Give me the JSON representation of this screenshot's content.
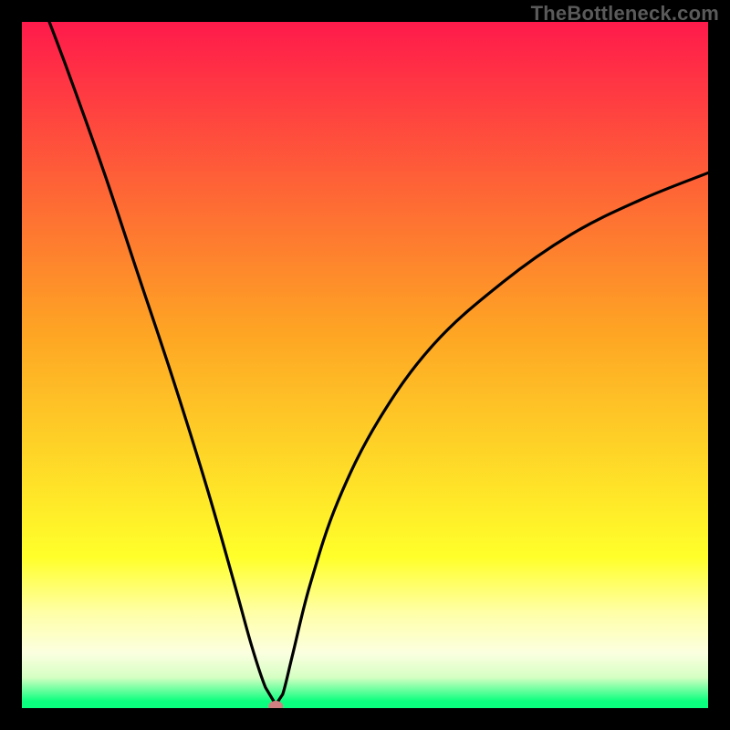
{
  "watermark": "TheBottleneck.com",
  "chart_data": {
    "type": "line",
    "title": "",
    "xlabel": "",
    "ylabel": "",
    "xlim": [
      0,
      100
    ],
    "ylim": [
      0,
      100
    ],
    "minimum_x": 37,
    "gradient_stops": [
      {
        "offset": 0.0,
        "color": "#ff1a4b"
      },
      {
        "offset": 0.45,
        "color": "#fea424"
      },
      {
        "offset": 0.78,
        "color": "#ffff2a"
      },
      {
        "offset": 0.86,
        "color": "#ffffa6"
      },
      {
        "offset": 0.92,
        "color": "#fbffe0"
      },
      {
        "offset": 0.955,
        "color": "#d6ffc3"
      },
      {
        "offset": 0.99,
        "color": "#0bff7e"
      }
    ],
    "marker": {
      "x": 37,
      "y": 0,
      "color": "#d08080",
      "rx": 8,
      "ry": 6
    },
    "curve_left": [
      {
        "x": 4.0,
        "y": 100.0
      },
      {
        "x": 7.0,
        "y": 92.0
      },
      {
        "x": 12.0,
        "y": 78.0
      },
      {
        "x": 17.0,
        "y": 63.0
      },
      {
        "x": 22.0,
        "y": 48.0
      },
      {
        "x": 27.0,
        "y": 32.0
      },
      {
        "x": 31.0,
        "y": 18.0
      },
      {
        "x": 33.5,
        "y": 9.0
      },
      {
        "x": 35.5,
        "y": 3.0
      },
      {
        "x": 37.0,
        "y": 0.5
      }
    ],
    "curve_right": [
      {
        "x": 37.0,
        "y": 0.5
      },
      {
        "x": 38.0,
        "y": 2.0
      },
      {
        "x": 39.5,
        "y": 8.0
      },
      {
        "x": 42.0,
        "y": 18.0
      },
      {
        "x": 46.0,
        "y": 30.0
      },
      {
        "x": 52.0,
        "y": 42.0
      },
      {
        "x": 60.0,
        "y": 53.0
      },
      {
        "x": 70.0,
        "y": 62.0
      },
      {
        "x": 80.0,
        "y": 69.0
      },
      {
        "x": 90.0,
        "y": 74.0
      },
      {
        "x": 100.0,
        "y": 78.0
      }
    ]
  }
}
